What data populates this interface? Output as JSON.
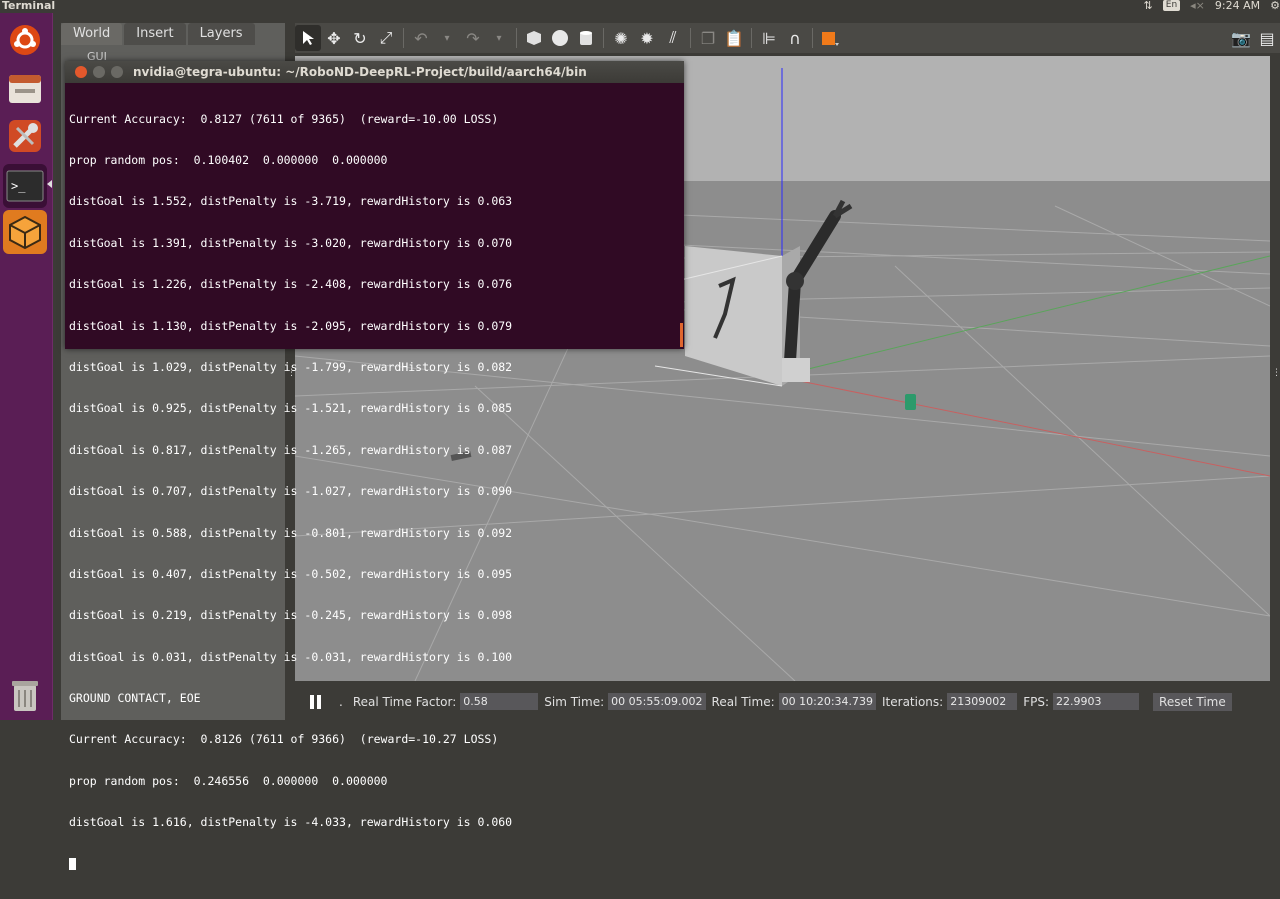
{
  "topbar": {
    "app_title": "Terminal",
    "input_lang": "En",
    "time": "9:24 AM"
  },
  "launcher": {
    "items": [
      "dash-icon",
      "files-icon",
      "settings-tools-icon",
      "terminal-icon",
      "gazebo-icon",
      "trash-icon"
    ]
  },
  "gazebo": {
    "tabs": [
      "World",
      "Insert",
      "Layers"
    ],
    "gui_label": "GUI",
    "status": {
      "rtf_label": "Real Time Factor:",
      "rtf_value": "0.58",
      "sim_label": "Sim Time:",
      "sim_value": "00 05:55:09.002",
      "real_label": "Real Time:",
      "real_value": "00 10:20:34.739",
      "iter_label": "Iterations:",
      "iter_value": "21309002",
      "fps_label": "FPS:",
      "fps_value": "22.9903",
      "reset_label": "Reset Time"
    }
  },
  "terminal": {
    "title": "nvidia@tegra-ubuntu: ~/RoboND-DeepRL-Project/build/aarch64/bin",
    "lines": [
      "Current Accuracy:  0.8127 (7611 of 9365)  (reward=-10.00 LOSS)",
      "prop random pos:  0.100402  0.000000  0.000000",
      "distGoal is 1.552, distPenalty is -3.719, rewardHistory is 0.063",
      "distGoal is 1.391, distPenalty is -3.020, rewardHistory is 0.070",
      "distGoal is 1.226, distPenalty is -2.408, rewardHistory is 0.076",
      "distGoal is 1.130, distPenalty is -2.095, rewardHistory is 0.079",
      "distGoal is 1.029, distPenalty is -1.799, rewardHistory is 0.082",
      "distGoal is 0.925, distPenalty is -1.521, rewardHistory is 0.085",
      "distGoal is 0.817, distPenalty is -1.265, rewardHistory is 0.087",
      "distGoal is 0.707, distPenalty is -1.027, rewardHistory is 0.090",
      "distGoal is 0.588, distPenalty is -0.801, rewardHistory is 0.092",
      "distGoal is 0.407, distPenalty is -0.502, rewardHistory is 0.095",
      "distGoal is 0.219, distPenalty is -0.245, rewardHistory is 0.098",
      "distGoal is 0.031, distPenalty is -0.031, rewardHistory is 0.100",
      "GROUND CONTACT, EOE",
      "Current Accuracy:  0.8126 (7611 of 9366)  (reward=-10.27 LOSS)",
      "prop random pos:  0.246556  0.000000  0.000000",
      "distGoal is 1.616, distPenalty is -4.033, rewardHistory is 0.060"
    ]
  },
  "colors": {
    "launcher_bg": "#5a1e55",
    "terminal_bg": "#300a24",
    "viewport_ground": "#8f8f8f"
  }
}
